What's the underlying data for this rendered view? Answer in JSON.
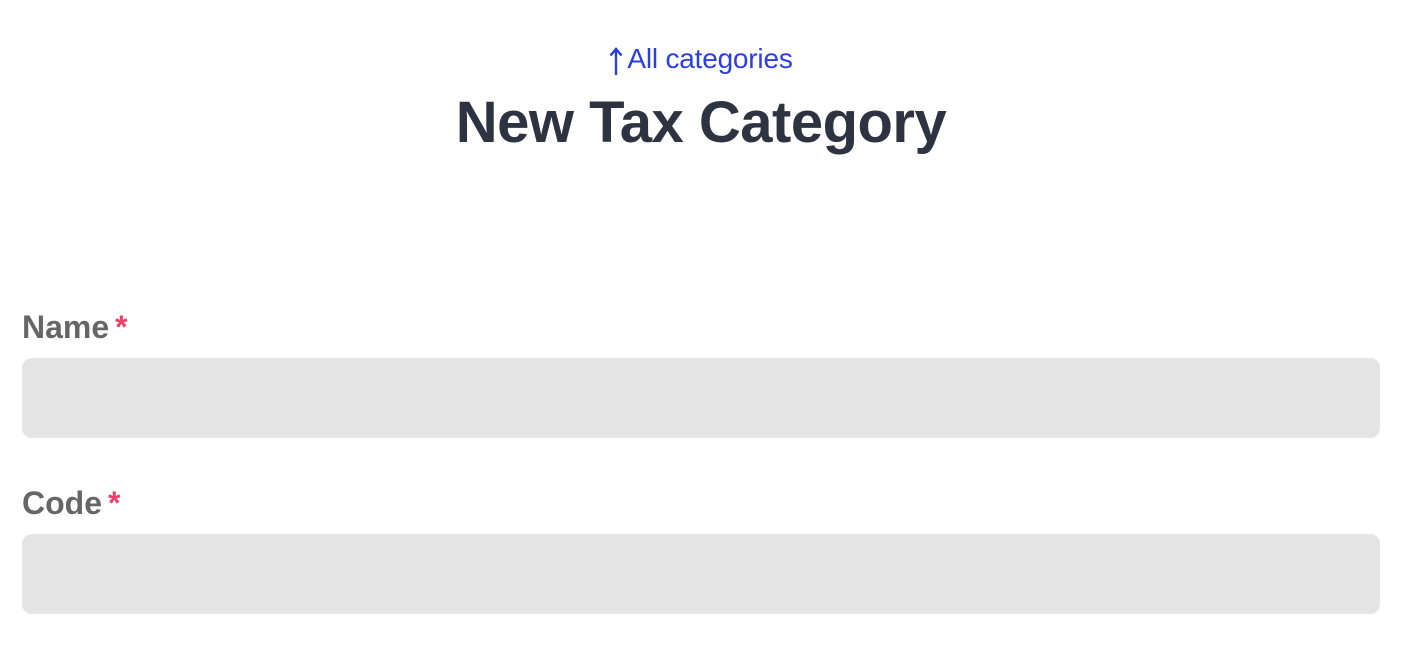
{
  "header": {
    "back_link_label": "All categories",
    "back_link_icon": "arrow-up-icon",
    "title": "New Tax Category"
  },
  "form": {
    "fields": [
      {
        "label": "Name",
        "required_mark": "*",
        "value": "",
        "placeholder": ""
      },
      {
        "label": "Code",
        "required_mark": "*",
        "value": "",
        "placeholder": ""
      }
    ]
  },
  "colors": {
    "link": "#2b3fe0",
    "title": "#2d3340",
    "label": "#666666",
    "required": "#ee3f6b",
    "input_bg": "#e4e4e4"
  }
}
